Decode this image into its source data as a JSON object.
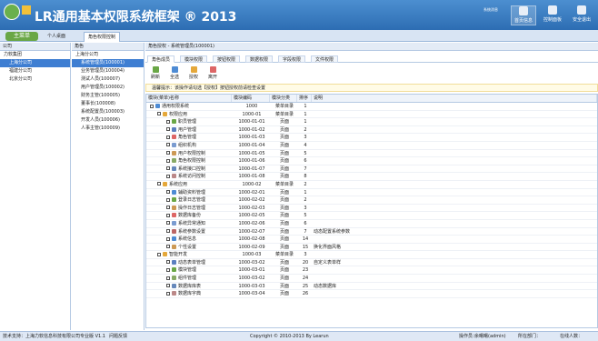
{
  "app": {
    "title": "LR通用基本权限系统框架 ® 2013"
  },
  "header": {
    "links": [
      "系统消息",
      "平台公告"
    ],
    "nav": [
      {
        "label": "首页信息"
      },
      {
        "label": "控制面板"
      },
      {
        "label": "安全退出"
      }
    ]
  },
  "tabs": {
    "main": "主菜单",
    "items": [
      "个人桌面",
      "角色权限控制"
    ]
  },
  "left": {
    "title": "公司",
    "items": [
      "力软集团",
      "上海分公司",
      "福建分公司",
      "北京分公司"
    ]
  },
  "mid": {
    "title": "角色",
    "items": [
      "上海分公司",
      "系统管理员(100001)",
      "业务管理员(100004)",
      "测试人员(100007)",
      "用户管理员(100002)",
      "财务主管(100005)",
      "董事长(100008)",
      "系统配置员(100003)",
      "开发人员(100006)",
      "人事主管(100009)"
    ]
  },
  "breadcrumb": "角色授权 - 系统管理员(100001)",
  "rtabs": [
    "角色成员",
    "模块权限",
    "按钮权限",
    "数据权限",
    "字段权限",
    "文件权限"
  ],
  "toolbar": [
    "刷新",
    "全选",
    "授权",
    "离开"
  ],
  "notice": "温馨提示：该操作请勾选【授权】按钮授权前请检查设置",
  "grid": {
    "headers": [
      "模块(菜单)名称",
      "模块编码",
      "模块分类",
      "排序",
      "说明"
    ],
    "rows": [
      {
        "n": "通用权限系统",
        "c": "1000",
        "t": "菜单目录",
        "s": "1",
        "d": "",
        "l": 1,
        "c1": "#4d8bd4"
      },
      {
        "n": "权限应用",
        "c": "1000-01",
        "t": "菜单目录",
        "s": "1",
        "d": "",
        "l": 2,
        "c1": "#e5a83a"
      },
      {
        "n": "职员管理",
        "c": "1000-01-01",
        "t": "页面",
        "s": "1",
        "d": "",
        "l": 3,
        "c1": "#6aa746"
      },
      {
        "n": "用户管理",
        "c": "1000-01-02",
        "t": "页面",
        "s": "2",
        "d": "",
        "l": 3,
        "c1": "#5b7fbf"
      },
      {
        "n": "角色管理",
        "c": "1000-01-03",
        "t": "页面",
        "s": "3",
        "d": "",
        "l": 3,
        "c1": "#d66"
      },
      {
        "n": "组织机构",
        "c": "1000-01-04",
        "t": "页面",
        "s": "4",
        "d": "",
        "l": 3,
        "c1": "#7a9bd0"
      },
      {
        "n": "用户权限控制",
        "c": "1000-01-05",
        "t": "页面",
        "s": "5",
        "d": "",
        "l": 3,
        "c1": "#c95"
      },
      {
        "n": "角色权限控制",
        "c": "1000-01-06",
        "t": "页面",
        "s": "6",
        "d": "",
        "l": 3,
        "c1": "#8a6"
      },
      {
        "n": "系统接口控制",
        "c": "1000-01-07",
        "t": "页面",
        "s": "7",
        "d": "",
        "l": 3,
        "c1": "#68b"
      },
      {
        "n": "系统访问控制",
        "c": "1000-01-08",
        "t": "页面",
        "s": "8",
        "d": "",
        "l": 3,
        "c1": "#b88"
      },
      {
        "n": "系统应用",
        "c": "1000-02",
        "t": "菜单目录",
        "s": "2",
        "d": "",
        "l": 2,
        "c1": "#e5a83a"
      },
      {
        "n": "辅助资料管理",
        "c": "1000-02-01",
        "t": "页面",
        "s": "1",
        "d": "",
        "l": 3,
        "c1": "#4d8bd4"
      },
      {
        "n": "登录日志管理",
        "c": "1000-02-02",
        "t": "页面",
        "s": "2",
        "d": "",
        "l": 3,
        "c1": "#6aa746"
      },
      {
        "n": "操作日志管理",
        "c": "1000-02-03",
        "t": "页面",
        "s": "3",
        "d": "",
        "l": 3,
        "c1": "#c95"
      },
      {
        "n": "数据库备份",
        "c": "1000-02-05",
        "t": "页面",
        "s": "5",
        "d": "",
        "l": 3,
        "c1": "#d66"
      },
      {
        "n": "系统异常通知",
        "c": "1000-02-06",
        "t": "页面",
        "s": "6",
        "d": "",
        "l": 3,
        "c1": "#7a9bd0"
      },
      {
        "n": "系统参数设置",
        "c": "1000-02-07",
        "t": "页面",
        "s": "7",
        "d": "动态配置系统参数",
        "l": 3,
        "c1": "#b66"
      },
      {
        "n": "系统信息",
        "c": "1000-02-08",
        "t": "页面",
        "s": "14",
        "d": "",
        "l": 3,
        "c1": "#4d8bd4"
      },
      {
        "n": "个性设置",
        "c": "1000-02-09",
        "t": "页面",
        "s": "15",
        "d": "换化界面风格",
        "l": 3,
        "c1": "#c95"
      },
      {
        "n": "智能开发",
        "c": "1000-03",
        "t": "菜单目录",
        "s": "3",
        "d": "",
        "l": 2,
        "c1": "#e5a83a"
      },
      {
        "n": "动态表单管理",
        "c": "1000-03-02",
        "t": "页面",
        "s": "20",
        "d": "自定义表单样",
        "l": 3,
        "c1": "#5b7fbf"
      },
      {
        "n": "模块管理",
        "c": "1000-03-01",
        "t": "页面",
        "s": "23",
        "d": "",
        "l": 3,
        "c1": "#6aa746"
      },
      {
        "n": "组件管理",
        "c": "1000-03-02",
        "t": "页面",
        "s": "24",
        "d": "",
        "l": 3,
        "c1": "#8a6"
      },
      {
        "n": "数据库库表",
        "c": "1000-03-03",
        "t": "页面",
        "s": "25",
        "d": "动态数据库",
        "l": 3,
        "c1": "#68b"
      },
      {
        "n": "数据库字典",
        "c": "1000-03-04",
        "t": "页面",
        "s": "26",
        "d": "",
        "l": 3,
        "c1": "#b88"
      }
    ]
  },
  "footer": {
    "left": "技术支持：上海力软信息科技有限公司",
    "ver": "专业版 V1.1",
    "q": "问题反馈",
    "copy": "Copyright © 2010-2013 By Learun",
    "ops": "操作员：",
    "user": "余曙曙(admin)",
    "dept": "所在部门：",
    "online": "在线人数："
  }
}
